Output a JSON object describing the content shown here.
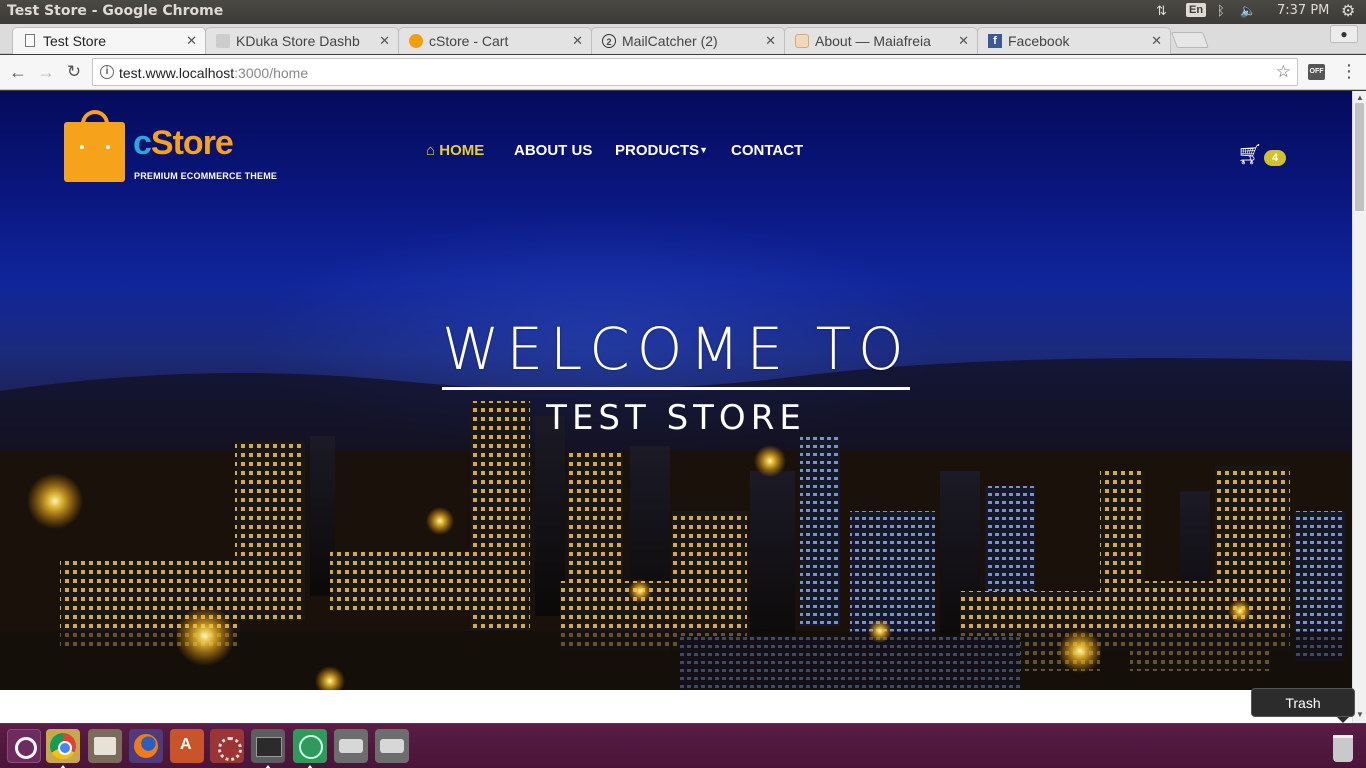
{
  "window": {
    "title": "Test Store - Google Chrome"
  },
  "indicators": {
    "keyboard": "En",
    "clock": "7:37 PM"
  },
  "tabs": [
    {
      "label": "Test Store",
      "favicon": "document-icon",
      "active": true
    },
    {
      "label": "KDuka Store Dashb",
      "favicon": "kduka-icon",
      "active": false
    },
    {
      "label": "cStore - Cart",
      "favicon": "cstore-icon",
      "active": false
    },
    {
      "label": "MailCatcher (2)",
      "favicon": "mailcatcher-icon",
      "badge": "2",
      "active": false
    },
    {
      "label": "About — Maiafreia",
      "favicon": "maiafreia-icon",
      "active": false
    },
    {
      "label": "Facebook",
      "favicon": "facebook-icon",
      "badge": "f",
      "active": false
    }
  ],
  "toolbar": {
    "url_host": "test.www.localhost",
    "url_rest": ":3000/home",
    "extension_label": "OFF"
  },
  "site": {
    "logo": {
      "wordmark_c": "c",
      "wordmark_rest": "Store",
      "tagline": "PREMIUM ECOMMERCE THEME"
    },
    "nav": {
      "home": "HOME",
      "about": "ABOUT US",
      "products": "PRODUCTS",
      "contact": "CONTACT"
    },
    "cart": {
      "count": "4"
    },
    "hero": {
      "title": "WELCOME TO",
      "subtitle": "TEST STORE"
    }
  },
  "dock": {
    "tooltip": "Trash",
    "items": [
      "ubuntu-dash-icon",
      "chrome-icon",
      "files-icon",
      "firefox-icon",
      "software-center-icon",
      "system-settings-icon",
      "terminal-icon",
      "atom-icon",
      "drive-icon",
      "drive-icon",
      "trash-icon"
    ]
  },
  "colors": {
    "brand_orange": "#f7a21b",
    "brand_blue": "#2aa7e0",
    "nav_active": "#e6cf2f",
    "cart_badge": "#d1c12a",
    "launcher_bg": "#4a1438"
  }
}
